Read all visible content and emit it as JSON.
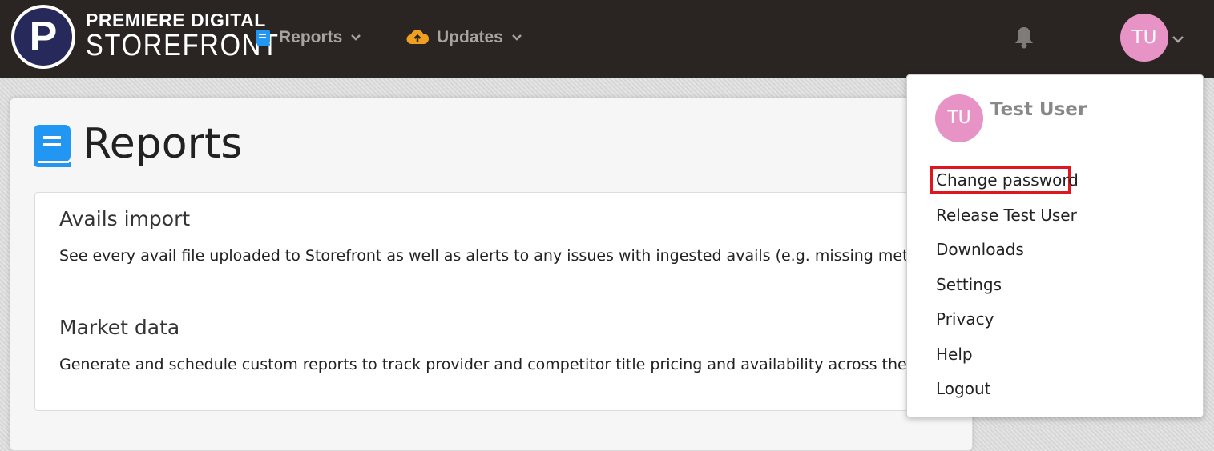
{
  "brand": {
    "logo_letter": "P",
    "line1": "PREMIERE DIGITAL",
    "line2": "STOREFRONT"
  },
  "nav": {
    "items": [
      {
        "label": "Reports",
        "icon": "book-icon",
        "color": "#2196f3"
      },
      {
        "label": "Updates",
        "icon": "cloud-upload-icon",
        "color": "#f0a020"
      }
    ],
    "notifications_icon": "bell-icon",
    "user_initials": "TU"
  },
  "page": {
    "title": "Reports",
    "reports": [
      {
        "title": "Avails import",
        "description": "See every avail file uploaded to Storefront as well as alerts to any issues with ingested avails (e.g. missing metadata"
      },
      {
        "title": "Market data",
        "description": "Generate and schedule custom reports to track provider and competitor title pricing and availability across the dig"
      }
    ]
  },
  "user_menu": {
    "initials": "TU",
    "name": "Test User",
    "items": [
      "Change password",
      "Release Test User",
      "Downloads",
      "Settings",
      "Privacy",
      "Help",
      "Logout"
    ],
    "highlighted_item": "Change password",
    "highlight_color": "#e0161f"
  },
  "colors": {
    "topbar": "#2a2522",
    "avatar": "#e893c6",
    "accent_blue": "#2196f3",
    "accent_orange": "#f0a020"
  }
}
